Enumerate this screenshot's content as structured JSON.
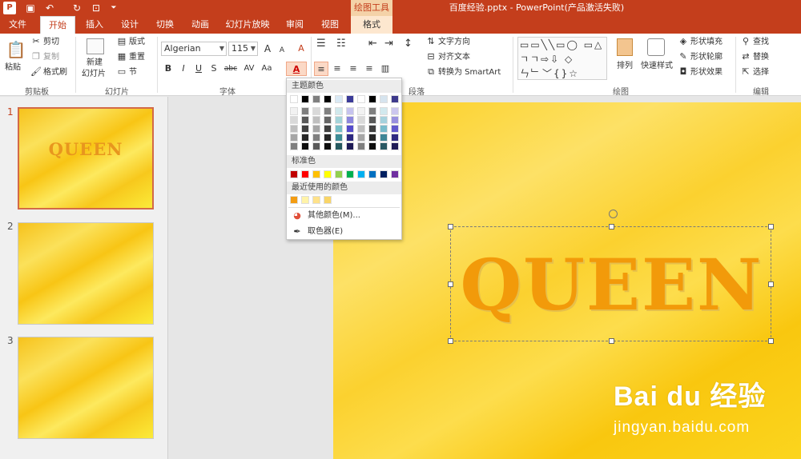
{
  "app": {
    "logo_letter": "P",
    "window_title": "百度经验.pptx - PowerPoint(产品激活失败)",
    "contextual_group": "绘图工具"
  },
  "qat": {
    "save": "▣",
    "undo": "↶",
    "redo": "↻",
    "present": "⊡",
    "customize": "⏷"
  },
  "tabs": [
    {
      "label": "文件"
    },
    {
      "label": "开始"
    },
    {
      "label": "插入"
    },
    {
      "label": "设计"
    },
    {
      "label": "切换"
    },
    {
      "label": "动画"
    },
    {
      "label": "幻灯片放映"
    },
    {
      "label": "审阅"
    },
    {
      "label": "视图"
    },
    {
      "label": "格式"
    }
  ],
  "ribbon": {
    "clipboard": {
      "paste": "粘贴",
      "cut": "剪切",
      "copy": "复制",
      "format_painter": "格式刷",
      "label": "剪贴板"
    },
    "slides": {
      "new_slide": "新建",
      "new_slide2": "幻灯片",
      "layout": "版式",
      "reset": "重置",
      "section": "节",
      "label": "幻灯片"
    },
    "font": {
      "font_name": "Algerian",
      "font_size": "115",
      "bold": "B",
      "italic": "I",
      "underline": "U",
      "shadow": "S",
      "strike": "abc",
      "spacing": "AV",
      "case": "Aa",
      "grow": "A",
      "shrink": "A",
      "clear": "A",
      "color": "A",
      "label": "字体"
    },
    "paragraph": {
      "label": "段落"
    },
    "text": {
      "direction": "文字方向",
      "align": "对齐文本",
      "smartart": "转换为 SmartArt"
    },
    "drawing": {
      "arrange": "排列",
      "quick_styles": "快速样式",
      "fill": "形状填充",
      "outline": "形状轮廓",
      "effects": "形状效果",
      "label": "绘图"
    },
    "editing": {
      "find": "查找",
      "replace": "替换",
      "select": "选择",
      "label": "编辑"
    }
  },
  "slides": [
    {
      "num": "1",
      "text": "QUEEN",
      "selected": true
    },
    {
      "num": "2",
      "text": "",
      "selected": false
    },
    {
      "num": "3",
      "text": "",
      "selected": false
    }
  ],
  "main_slide": {
    "text": "QUEEN"
  },
  "palette": {
    "theme_header": "主题颜色",
    "standard_header": "标准色",
    "recent_header": "最近使用的颜色",
    "more_colors": "其他颜色(M)...",
    "eyedropper": "取色器(E)",
    "theme_top": [
      "#ffffff",
      "#000000",
      "#7f7f7f",
      "#000000",
      "#d9e9f5",
      "#3b3b98",
      "#ffffff",
      "#000000",
      "#d6e4ee",
      "#3e3a8c"
    ],
    "theme_cols": [
      [
        "#f2f2f2",
        "#d9d9d9",
        "#bfbfbf",
        "#a6a6a6",
        "#7f7f7f"
      ],
      [
        "#7f7f7f",
        "#595959",
        "#404040",
        "#262626",
        "#0d0d0d"
      ],
      [
        "#d9d9d9",
        "#bfbfbf",
        "#a6a6a6",
        "#7f7f7f",
        "#595959"
      ],
      [
        "#808080",
        "#666666",
        "#404040",
        "#262626",
        "#0d0d0d"
      ],
      [
        "#d0e8ec",
        "#a4d4da",
        "#78bfc8",
        "#3d8c96",
        "#26595f"
      ],
      [
        "#c6c3ee",
        "#8d87dd",
        "#554ccb",
        "#2c2880",
        "#1d1a55"
      ],
      [
        "#f2f2f2",
        "#d9d9d9",
        "#bfbfbf",
        "#a6a6a6",
        "#7f7f7f"
      ],
      [
        "#7f7f7f",
        "#595959",
        "#404040",
        "#262626",
        "#0d0d0d"
      ],
      [
        "#d2e9ee",
        "#a6d2dd",
        "#79bccb",
        "#3f8696",
        "#2a5964"
      ],
      [
        "#cbc6ee",
        "#9890de",
        "#6259cc",
        "#2f2a81",
        "#1f1c56"
      ]
    ],
    "standard": [
      "#c00000",
      "#ff0000",
      "#ffc000",
      "#ffff00",
      "#92d050",
      "#00b050",
      "#00b0f0",
      "#0070c0",
      "#002060",
      "#7030a0"
    ],
    "recent": [
      "#f39c12",
      "#fff3a8",
      "#ffe28a",
      "#f9d568"
    ]
  },
  "watermark": {
    "logo": "Bai du 经验",
    "url": "jingyan.baidu.com"
  }
}
